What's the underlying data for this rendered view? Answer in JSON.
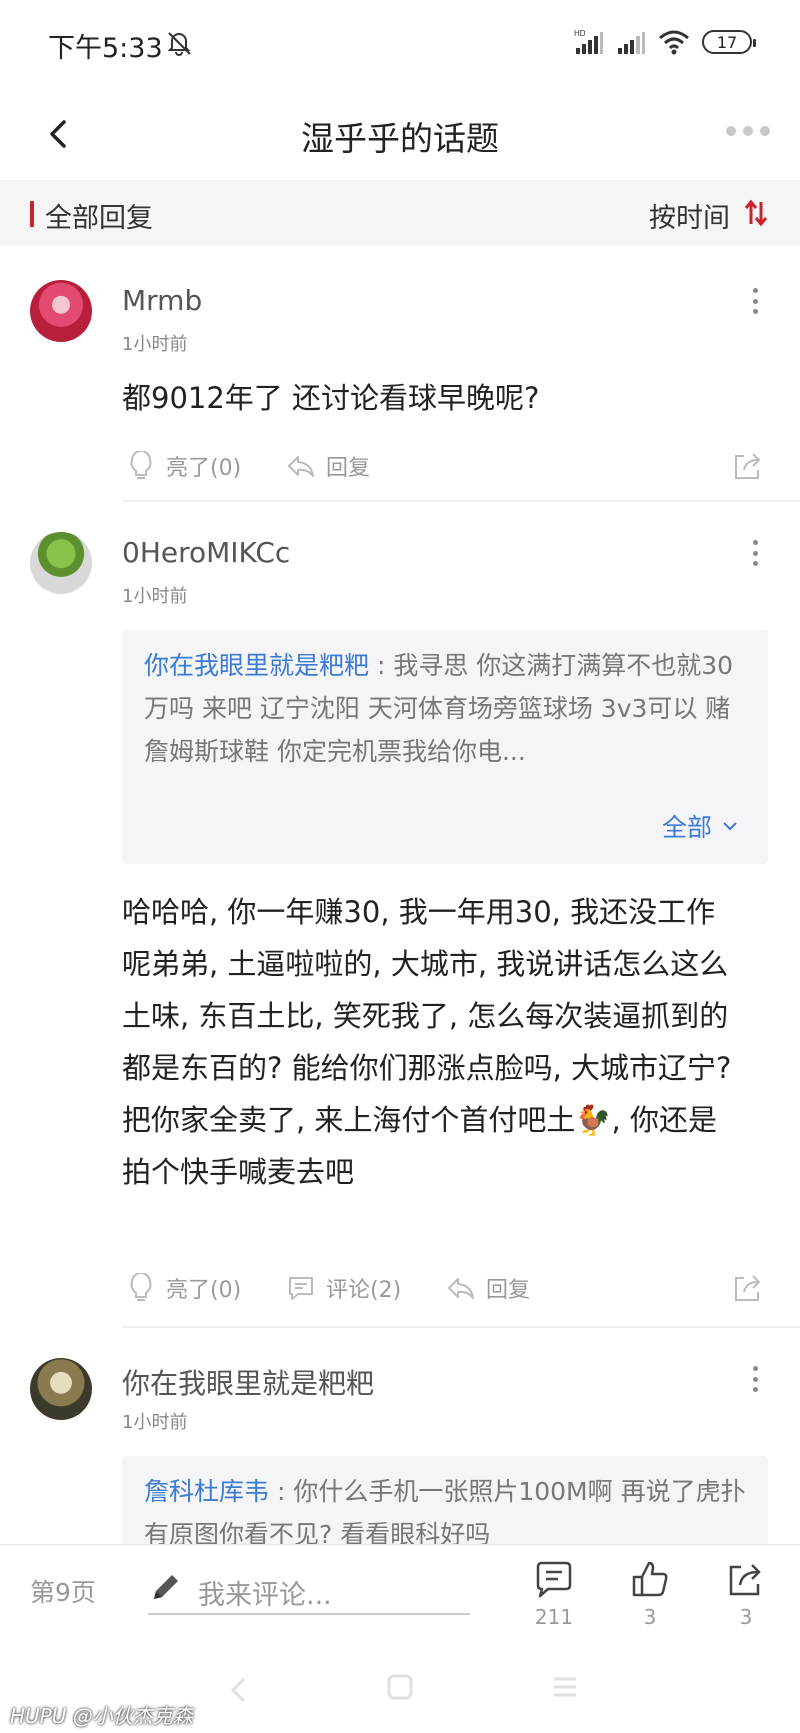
{
  "status_bar": {
    "time": "下午5:33",
    "battery": "17"
  },
  "header": {
    "title": "湿乎乎的话题"
  },
  "section": {
    "title": "全部回复",
    "sort_label": "按时间"
  },
  "posts": [
    {
      "username": "Mrmb",
      "time": "1小时前",
      "content": "都9012年了 还讨论看球早晚呢?",
      "like_label": "亮了(0)",
      "reply_label": "回复"
    },
    {
      "username": "0HeroMIKCc",
      "time": "1小时前",
      "quote": {
        "author": "你在我眼里就是粑粑",
        "text": " : 我寻思 你这满打满算不也就30万吗 来吧 辽宁沈阳 天河体育场旁篮球场 3v3可以 赌詹姆斯球鞋 你定完机票我给你电...",
        "expand_label": "全部"
      },
      "content": "哈哈哈, 你一年赚30, 我一年用30, 我还没工作呢弟弟, 土逼啦啦的, 大城市, 我说讲话怎么这么土味, 东百土比, 笑死我了, 怎么每次装逼抓到的都是东百的? 能给你们那涨点脸吗, 大城市辽宁? 把你家全卖了, 来上海付个首付吧土🐓, 你还是拍个快手喊麦去吧",
      "like_label": "亮了(0)",
      "comment_label": "评论(2)",
      "reply_label": "回复"
    },
    {
      "username": "你在我眼里就是粑粑",
      "time": "1小时前",
      "quote": {
        "author": "詹科杜库韦",
        "text": " : 你什么手机一张照片100M啊 再说了虎扑有原图你看不见? 看看眼科好吗"
      }
    }
  ],
  "bottom_bar": {
    "page": "第9页",
    "comment_placeholder": "我来评论...",
    "comments_count": "211",
    "likes_count": "3",
    "shares_count": "3"
  },
  "watermark": "HUPU @小伙杰克森",
  "colors": {
    "accent_red": "#c8242f",
    "link_blue": "#3a7bd5"
  }
}
